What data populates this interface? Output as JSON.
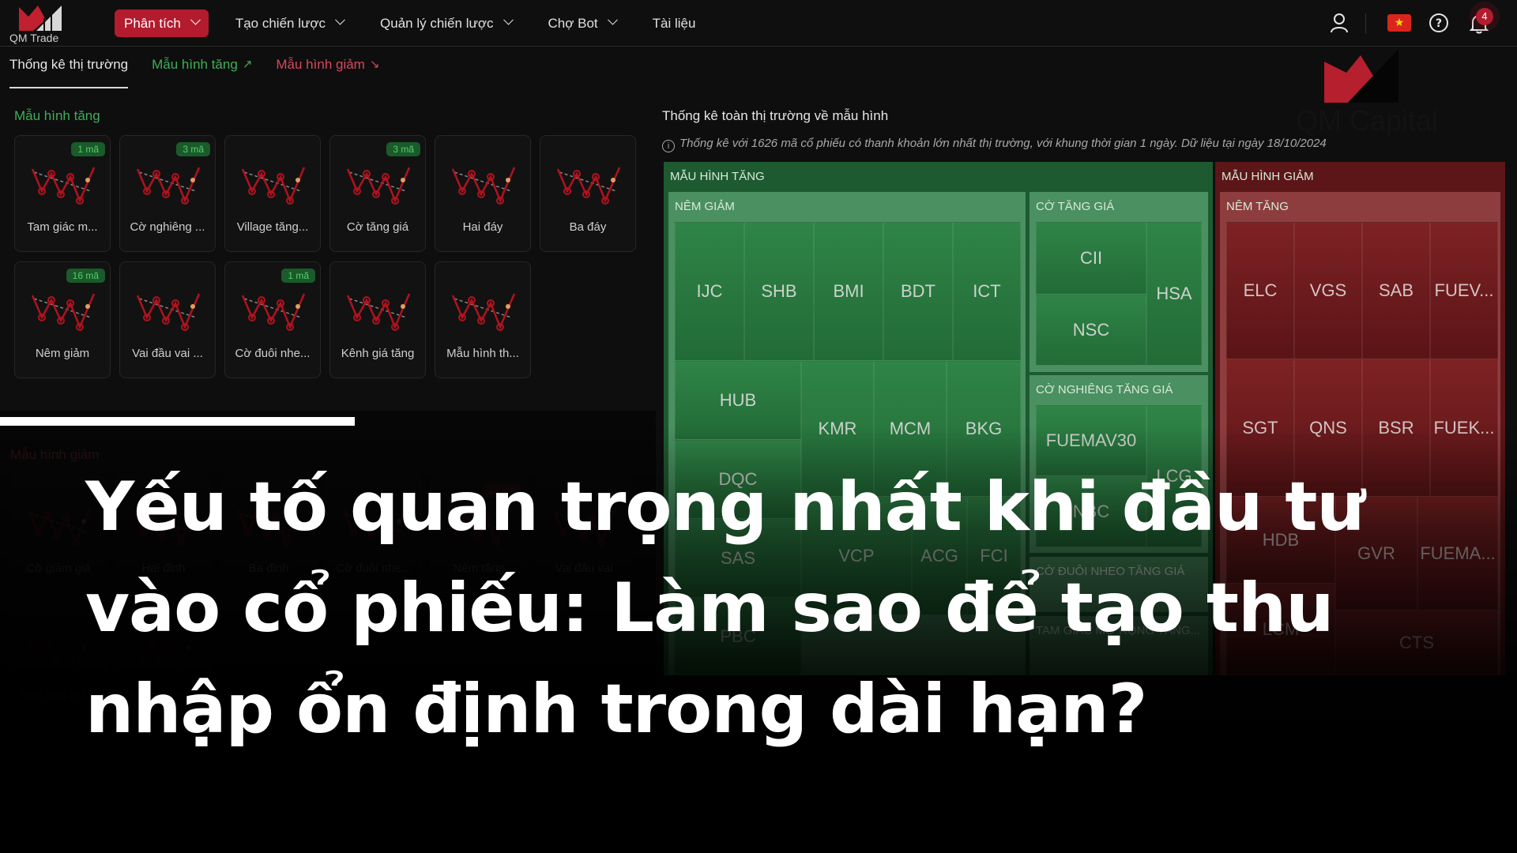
{
  "brand": {
    "logo_text": "QM Trade",
    "accent": "#b31b2e",
    "up_color": "#3fae58",
    "down_color": "#d6485c"
  },
  "nav": {
    "items": [
      {
        "label": "Phân tích",
        "active": true,
        "dropdown": true
      },
      {
        "label": "Tạo chiến lược",
        "dropdown": true
      },
      {
        "label": "Quản lý chiến lược",
        "dropdown": true
      },
      {
        "label": "Chợ Bot",
        "dropdown": true
      },
      {
        "label": "Tài liệu",
        "dropdown": false
      }
    ],
    "notification_count": "4",
    "icons": [
      "user-icon",
      "vietnam-flag-icon",
      "help-icon",
      "bell-icon"
    ]
  },
  "tabs": [
    {
      "label": "Thống kê thị trường",
      "active": true
    },
    {
      "label": "Mẫu hình tăng",
      "icon": "trend-up-icon",
      "glyph": "↗"
    },
    {
      "label": "Mẫu hình giảm",
      "icon": "trend-down-icon",
      "glyph": "↘"
    }
  ],
  "bullish": {
    "title": "Mẫu hình tăng",
    "cards": [
      {
        "label": "Tam giác m...",
        "badge": "1 mã"
      },
      {
        "label": "Cờ nghiêng ...",
        "badge": "3 mã"
      },
      {
        "label": "Village tăng...",
        "badge": ""
      },
      {
        "label": "Cờ tăng giá",
        "badge": "3 mã"
      },
      {
        "label": "Hai đáy",
        "badge": ""
      },
      {
        "label": "Ba đáy",
        "badge": ""
      },
      {
        "label": "Nêm giảm",
        "badge": "16 mã"
      },
      {
        "label": "Vai đầu vai ...",
        "badge": ""
      },
      {
        "label": "Cờ đuôi nhe...",
        "badge": "1 mã"
      },
      {
        "label": "Kênh giá tăng",
        "badge": ""
      },
      {
        "label": "Mẫu hình th...",
        "badge": ""
      }
    ]
  },
  "bearish": {
    "title": "Mẫu hình giảm",
    "cards": [
      {
        "label": "Cờ giảm giá",
        "badge": ""
      },
      {
        "label": "Hai đỉnh",
        "badge": ""
      },
      {
        "label": "Ba đỉnh",
        "badge": ""
      },
      {
        "label": "Cờ đuôi nhe...",
        "badge": ""
      },
      {
        "label": "Nêm tăng",
        "badge": "12 mã"
      },
      {
        "label": "Vai đầu vai",
        "badge": ""
      },
      {
        "label": "Tam giác mở...",
        "badge": ""
      },
      {
        "label": "Kênh giảm ...",
        "badge": ""
      }
    ]
  },
  "treemap": {
    "title": "Thống kê toàn thị trường về mẫu hình",
    "note": "Thống kê với 1626 mã cổ phiếu có thanh khoản lớn nhất thị trường, với khung thời gian 1 ngày. Dữ liệu tại ngày 18/10/2024",
    "up_group": {
      "label": "Mẫu hình tăng",
      "nem_giam": {
        "label": "Nêm giảm",
        "tickers": [
          "IJC",
          "SHB",
          "BMI",
          "BDT",
          "ICT",
          "HUB",
          "KMR",
          "MCM",
          "BKG",
          "DQC",
          "VCP",
          "SAS",
          "ACG",
          "FCI",
          "PBC"
        ]
      },
      "co_tang_gia": {
        "label": "Cờ tăng giá",
        "tickers": [
          "CII",
          "HSA",
          "NSC"
        ]
      },
      "co_nghieng": {
        "label": "Cờ nghiêng tăng giá",
        "tickers": [
          "FUEMAV30",
          "LCG",
          "NBC"
        ]
      },
      "co_duoi_nheo": {
        "label": "Cờ đuôi nheo tăng giá"
      },
      "tam_giac": {
        "label": "Tam giác mở rộng tăng..."
      }
    },
    "down_group": {
      "label": "Mẫu hình giảm",
      "nem_tang": {
        "label": "Nêm tăng",
        "tickers": [
          "ELC",
          "VGS",
          "SAB",
          "FUEV...",
          "SGT",
          "QNS",
          "BSR",
          "FUEK...",
          "HDB",
          "GVR",
          "FUEMA...",
          "LCM",
          "CTS"
        ]
      }
    }
  },
  "watermark": {
    "text": "QM Capital"
  },
  "banner": {
    "lines": [
      "Yếu tố quan trọng nhất khi đầu tư",
      "vào cổ phiếu: Làm sao để tạo thu",
      "nhập ổn định trong dài hạn?"
    ]
  }
}
